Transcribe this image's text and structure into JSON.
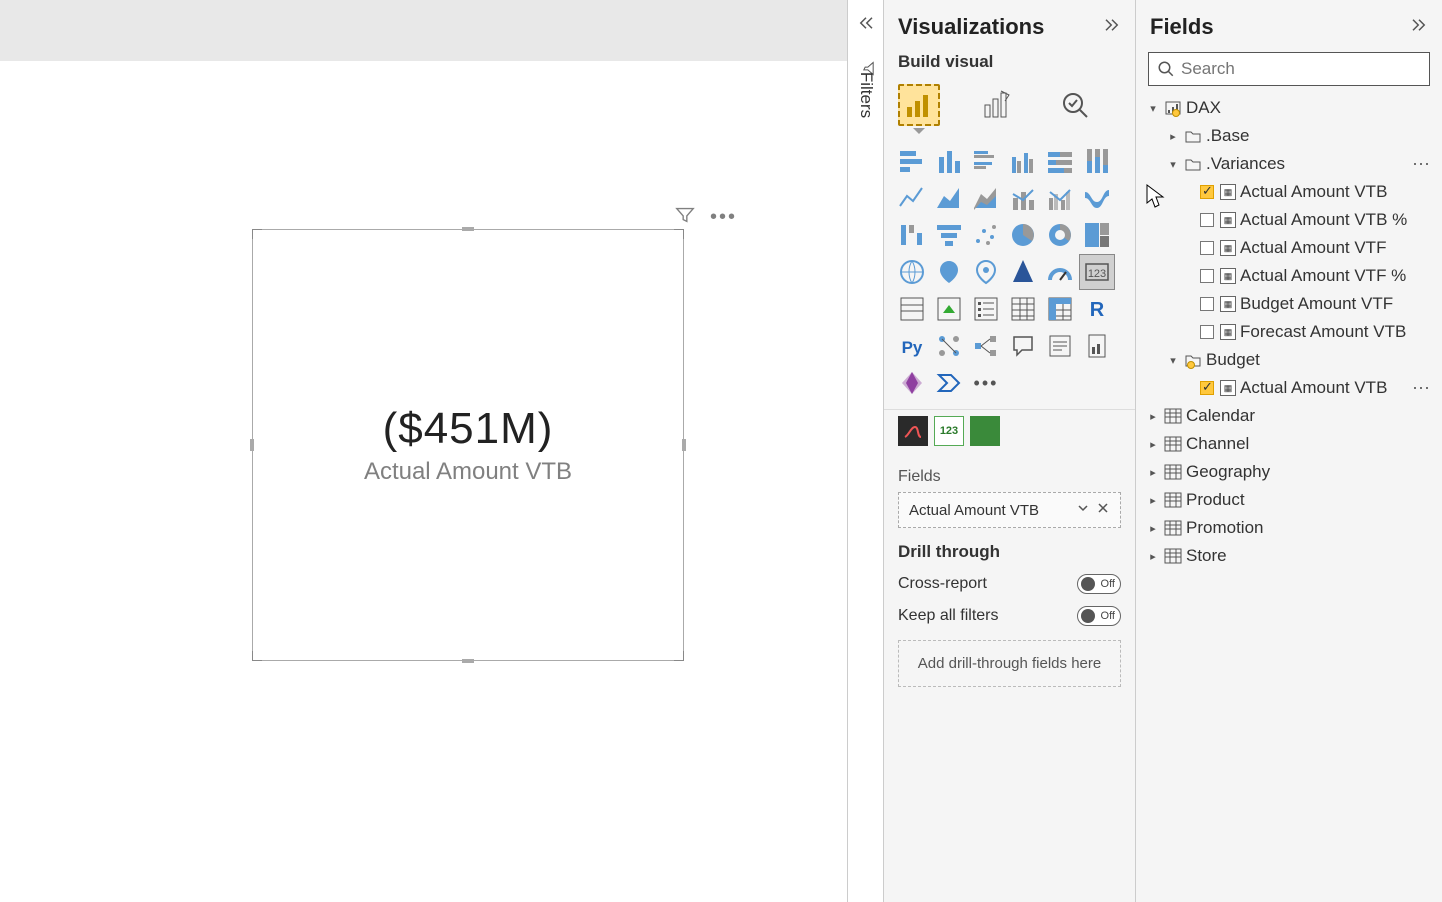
{
  "card": {
    "value": "($451M)",
    "label": "Actual Amount VTB"
  },
  "filters": {
    "label": "Filters"
  },
  "visualizations": {
    "title": "Visualizations",
    "build_label": "Build visual",
    "fields_section": "Fields",
    "field_well_value": "Actual Amount VTB",
    "drill_label": "Drill through",
    "cross_report": "Cross-report",
    "keep_filters": "Keep all filters",
    "toggle_off": "Off",
    "drop_hint": "Add drill-through fields here"
  },
  "fields": {
    "title": "Fields",
    "search_placeholder": "Search",
    "tree": {
      "dax": "DAX",
      "base": ".Base",
      "variances": ".Variances",
      "variance_items": [
        {
          "label": "Actual Amount VTB",
          "checked": true
        },
        {
          "label": "Actual Amount VTB %",
          "checked": false
        },
        {
          "label": "Actual Amount VTF",
          "checked": false
        },
        {
          "label": "Actual Amount VTF %",
          "checked": false
        },
        {
          "label": "Budget Amount VTF",
          "checked": false
        },
        {
          "label": "Forecast Amount VTB",
          "checked": false
        }
      ],
      "budget": "Budget",
      "budget_items": [
        {
          "label": "Actual Amount VTB",
          "checked": true
        }
      ],
      "tables": [
        "Calendar",
        "Channel",
        "Geography",
        "Product",
        "Promotion",
        "Store"
      ]
    }
  }
}
